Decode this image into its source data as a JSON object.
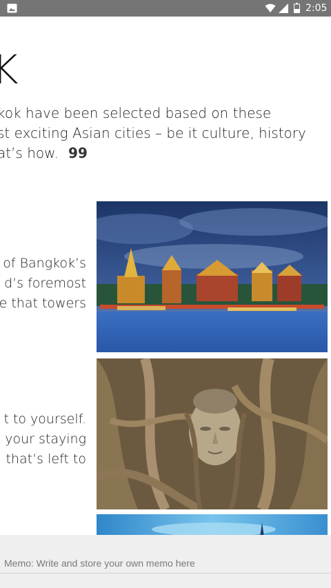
{
  "status_bar": {
    "time": "2:05",
    "icons": [
      "gallery-icon",
      "wifi-icon",
      "signal-icon",
      "battery-icon"
    ]
  },
  "article": {
    "title": "OK",
    "intro_lines": [
      "kok have been selected based on these",
      "st exciting Asian cities – be it culture, history",
      "at’s how."
    ],
    "quote_mark": "99",
    "section_1_lines": [
      "of Bangkok’s",
      "d’s foremost",
      "e that towers"
    ],
    "section_2_lines": [
      "t to yourself.",
      "your staying",
      "that’s left to"
    ],
    "images": [
      {
        "name": "grand-palace-photo",
        "description_colors": [
          "#2a4b8c",
          "#d9a632",
          "#3f74c4"
        ]
      },
      {
        "name": "buddha-head-tree-roots-photo",
        "description_colors": [
          "#8b7355",
          "#5c4a32"
        ]
      },
      {
        "name": "third-photo-partial",
        "description_colors": [
          "#3a8fd0",
          "#6cc0ea"
        ]
      }
    ]
  },
  "memo": {
    "placeholder": "Memo: Write and store your own memo here",
    "value": ""
  },
  "colors": {
    "status_bar_bg": "#757575",
    "memo_bar_bg": "#efefef",
    "text": "#222222"
  }
}
